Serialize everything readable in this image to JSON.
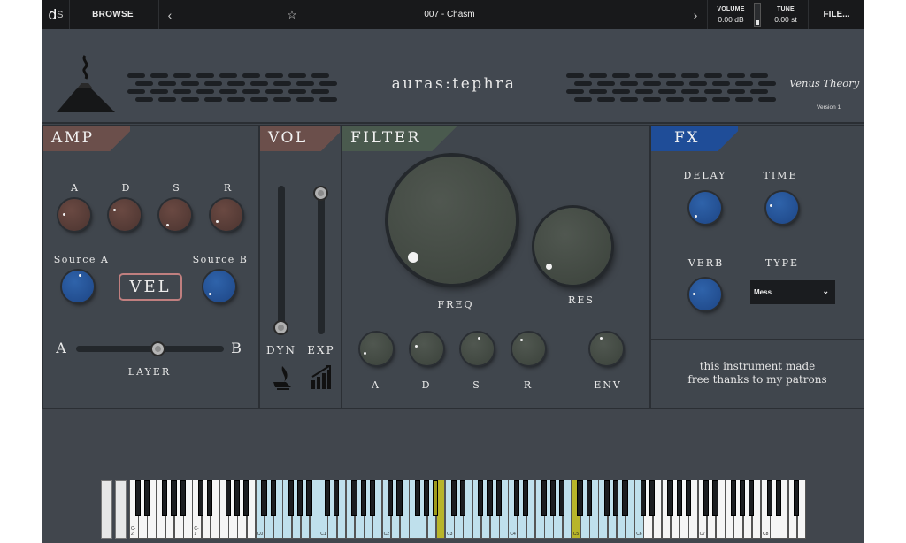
{
  "topbar": {
    "logo": "d",
    "logo_sub": "S",
    "browse_label": "BROWSE",
    "prev_icon": "‹",
    "next_icon": "›",
    "favorite_icon": "☆",
    "preset_name": "007 - Chasm",
    "volume_label": "VOLUME",
    "volume_value": "0.00 dB",
    "volume_meter_level": 0.2,
    "tune_label": "TUNE",
    "tune_value": "0.00 st",
    "file_label": "FILE..."
  },
  "header": {
    "title": "auras:tephra",
    "brand": "Venus Theory",
    "version": "Version 1"
  },
  "amp": {
    "title": "AMP",
    "knobs": [
      {
        "label": "A",
        "value": 0.15
      },
      {
        "label": "D",
        "value": 0.1
      },
      {
        "label": "S",
        "value": 0.1
      },
      {
        "label": "R",
        "value": 0.4
      }
    ],
    "source_a_label": "Source A",
    "source_b_label": "Source B",
    "vel_label": "VEL",
    "layer_left": "A",
    "layer_right": "B",
    "layer_label": "LAYER",
    "layer_value": 0.55
  },
  "vol": {
    "title": "VOL",
    "dyn_label": "DYN",
    "exp_label": "EXP",
    "dyn_value": 0.0,
    "exp_value": 1.0,
    "dyn_icon": "flame-hand-icon",
    "exp_icon": "bar-graph-up-icon"
  },
  "filter": {
    "title": "FILTER",
    "freq_label": "FREQ",
    "res_label": "RES",
    "env_labels": [
      "A",
      "D",
      "S",
      "R"
    ],
    "env_label": "ENV"
  },
  "fx": {
    "title": "FX",
    "delay_label": "DELAY",
    "time_label": "TIME",
    "verb_label": "VERB",
    "type_label": "TYPE",
    "type_value": "Mess",
    "patrons_line1": "this instrument made",
    "patrons_line2": "free thanks to my patrons"
  },
  "keyboard": {
    "octave_labels": [
      "C-2",
      "C-1",
      "C0",
      "C1",
      "C2",
      "C3",
      "C4",
      "C5",
      "C6",
      "C7",
      "C8"
    ]
  },
  "colors": {
    "amp_tag": "#6b4f4b",
    "vol_tag": "#6b4f4b",
    "filter_tag": "#4a5a4e",
    "fx_tag": "#1f4d98",
    "key_range": "#bfe0ec",
    "key_active": "#b8b52a"
  }
}
